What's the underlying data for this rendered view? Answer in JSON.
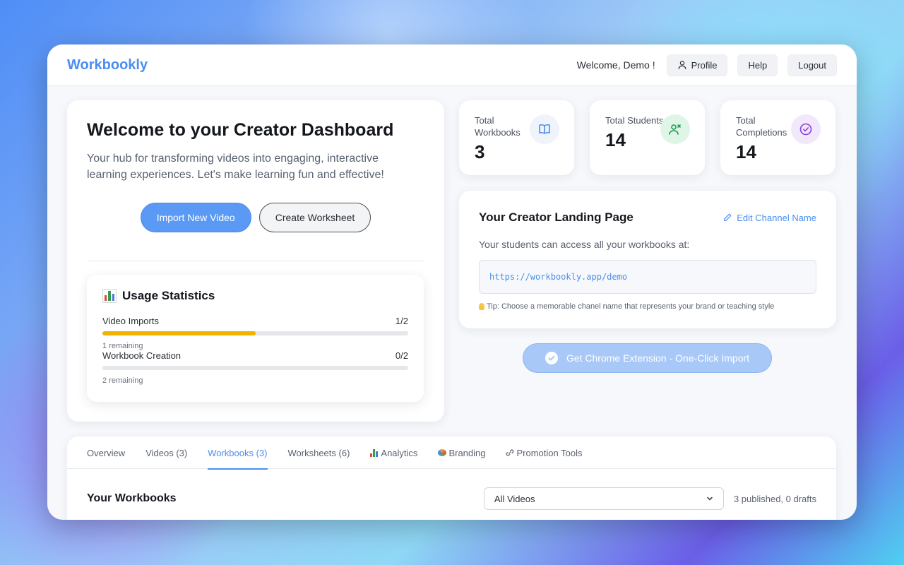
{
  "app": {
    "logo": "Workbookly",
    "welcome": "Welcome, Demo !",
    "nav": {
      "profile": "Profile",
      "help": "Help",
      "logout": "Logout"
    }
  },
  "hero": {
    "title": "Welcome to your Creator Dashboard",
    "subtitle": "Your hub for transforming videos into engaging, interactive learning experiences. Let's make learning fun and effective!",
    "import_btn": "Import New Video",
    "create_btn": "Create Worksheet"
  },
  "usage": {
    "title": "Usage Statistics",
    "items": [
      {
        "label": "Video Imports",
        "count": "1/2",
        "remaining": "1 remaining",
        "fraction": 0.5
      },
      {
        "label": "Workbook Creation",
        "count": "0/2",
        "remaining": "2 remaining",
        "fraction": 0
      }
    ]
  },
  "stats": [
    {
      "label": "Total Workbooks",
      "value": "3",
      "icon": "book-icon",
      "color": "#4a8ef0",
      "bg": "#eef3fc"
    },
    {
      "label": "Total Students",
      "value": "14",
      "icon": "users-icon",
      "color": "#1e9a52",
      "bg": "#dff5e6"
    },
    {
      "label": "Total Completions",
      "value": "14",
      "icon": "check-circle-icon",
      "color": "#8a3fe0",
      "bg": "#f1e8fc"
    }
  ],
  "landing": {
    "title": "Your Creator Landing Page",
    "edit": "Edit Channel Name",
    "desc": "Your students can access all your workbooks at:",
    "url": "https://workbookly.app/demo",
    "tip": "Tip: Choose a memorable chanel name that represents your brand or teaching style"
  },
  "chrome_btn": "Get Chrome Extension - One-Click Import",
  "tabs": [
    {
      "label": "Overview",
      "active": false
    },
    {
      "label": "Videos (3)",
      "active": false
    },
    {
      "label": "Workbooks (3)",
      "active": true
    },
    {
      "label": "Worksheets (6)",
      "active": false
    },
    {
      "label": "Analytics",
      "active": false,
      "icon": "chart-icon"
    },
    {
      "label": "Branding",
      "active": false,
      "icon": "palette-icon"
    },
    {
      "label": "Promotion Tools",
      "active": false,
      "icon": "link-icon"
    }
  ],
  "workbooks": {
    "title": "Your Workbooks",
    "filter": "All Videos",
    "count": "3 published, 0 drafts"
  },
  "colors": {
    "accent": "#4a8ef0",
    "progress": "#f0b400"
  }
}
